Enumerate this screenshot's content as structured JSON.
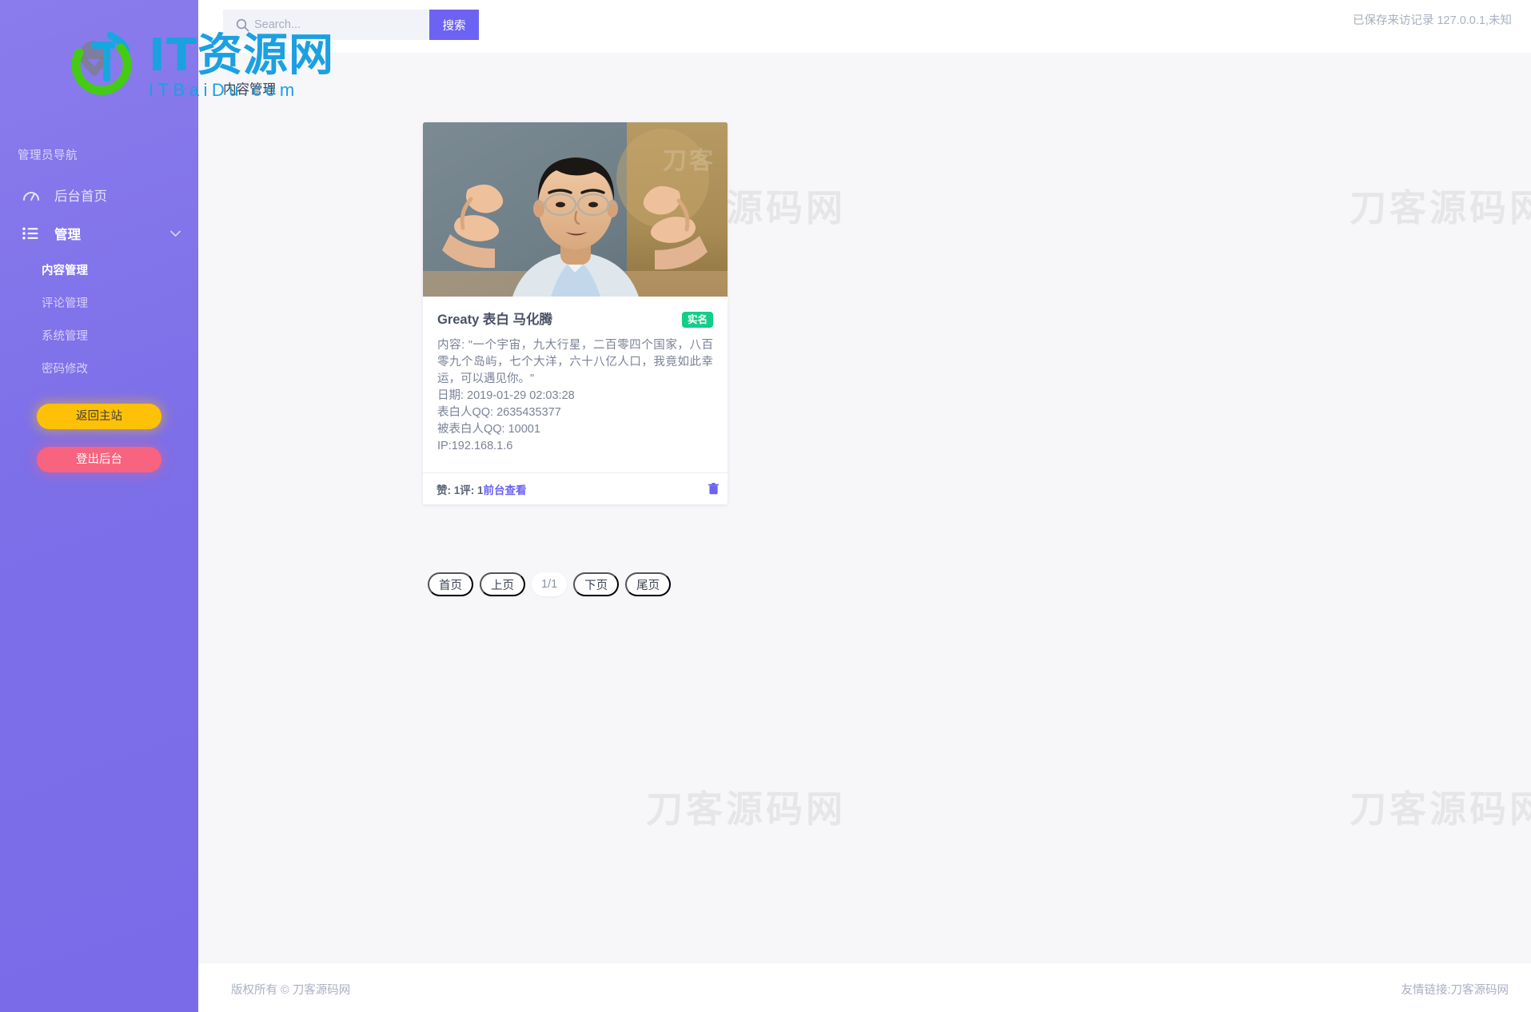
{
  "brand": {
    "title": "IT资源网",
    "subtitle": "ITBaiDu.com",
    "logo_icon": "it-circle-logo-icon"
  },
  "topbar": {
    "search_placeholder": "Search...",
    "search_value": "",
    "search_button_label": "搜索",
    "search_icon": "search-icon",
    "visit_record": "已保存来访记录 127.0.0.1,未知"
  },
  "sidebar": {
    "nav_heading": "管理员导航",
    "items": [
      {
        "label": "后台首页",
        "icon": "dashboard-gauge-icon",
        "type": "link"
      },
      {
        "label": "管理",
        "icon": "list-bullet-icon",
        "type": "group",
        "chevron": "chevron-down-icon"
      }
    ],
    "sub_items": [
      {
        "label": "内容管理",
        "active": true
      },
      {
        "label": "评论管理",
        "active": false
      },
      {
        "label": "系统管理",
        "active": false
      },
      {
        "label": "密码修改",
        "active": false
      }
    ],
    "buttons": [
      {
        "label": "返回主站",
        "color": "#ffc107"
      },
      {
        "label": "登出后台",
        "color": "#f8637f"
      }
    ]
  },
  "main": {
    "page_title": "内容管理",
    "watermark": "刀客源码网",
    "card": {
      "photo_alt": "portrait-photo",
      "title": "Greaty 表白 马化腾",
      "badge": "实名",
      "content_label": "内容:",
      "content_text": "\"一个宇宙，九大行星，二百零四个国家，八百零九个岛屿，七个大洋，六十八亿人口，我竟如此幸运，可以遇见你。\"",
      "date": "日期: 2019-01-29 02:03:28",
      "sender_qq": "表白人QQ: 2635435377",
      "receiver_qq": "被表白人QQ: 10001",
      "ip": "IP:192.168.1.6",
      "stats": "赞: 1评: 1",
      "front_link": "前台查看",
      "delete_icon": "trash-icon"
    },
    "pagination": [
      {
        "label": "首页",
        "kind": "button"
      },
      {
        "label": "上页",
        "kind": "button"
      },
      {
        "label": "1/1",
        "kind": "indicator"
      },
      {
        "label": "下页",
        "kind": "button"
      },
      {
        "label": "尾页",
        "kind": "button"
      }
    ]
  },
  "footer": {
    "copyright": "版权所有 © 刀客源码网",
    "friend_link": "友情链接:刀客源码网"
  },
  "colors": {
    "sidebar_gradient_start": "#8b7ced",
    "sidebar_gradient_end": "#7a6ce8",
    "accent_purple": "#6c63f2",
    "badge_green": "#13ce89",
    "button_yellow": "#ffc107",
    "button_pink": "#f8637f",
    "brand_blue": "#1ba0e2",
    "content_bg": "#f7f7fa"
  }
}
